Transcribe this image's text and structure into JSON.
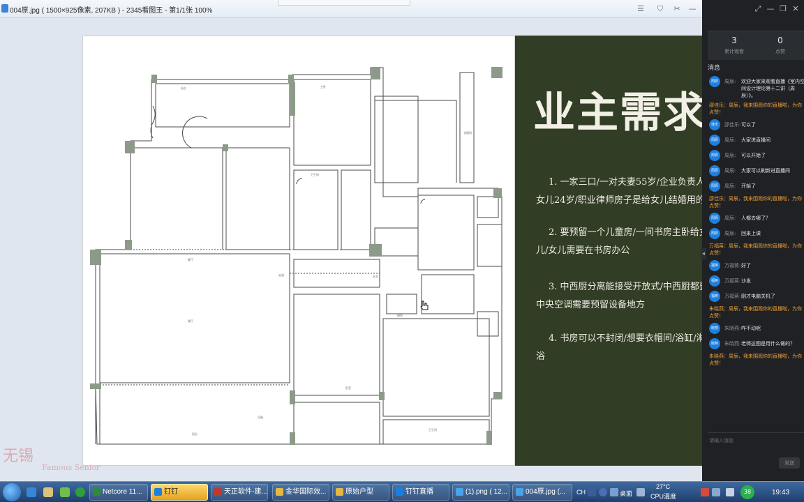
{
  "viewer": {
    "title": "004原.jpg ( 1500×925像素, 207KB ) - 2345看图王 - 第1/1张 100%",
    "controls": [
      "☰",
      "⛉",
      "✂",
      "—",
      "❐",
      "✕"
    ]
  },
  "slide": {
    "title": "业主需求",
    "requirements": [
      [
        "1. 一家三口/一对夫妻55岁/企业负责人",
        "女儿24岁/职业律师房子是给女儿结婚用的"
      ],
      [
        "2. 要预留一个儿童房/一间书房主卧给女",
        "儿/女儿需要在书房办公"
      ],
      [
        "3. 中西厨分离能接受开放式/中西厨都要",
        "中央空调需要预留设备地方"
      ],
      [
        "4. 书房可以不封闭/想要衣帽间/浴缸/淋",
        "浴"
      ]
    ]
  },
  "watermark": {
    "main": "无锡",
    "sub": "Famous Senior"
  },
  "live": {
    "controls": [
      "⤢",
      "—",
      "❐",
      "✕"
    ],
    "stats": [
      {
        "value": "3",
        "label": "累计观看"
      },
      {
        "value": "0",
        "label": "点赞"
      }
    ],
    "messages_header": "消息",
    "messages": [
      {
        "type": "user",
        "avatar": "周辰",
        "name": "周辰:",
        "text": "欢迎大家来观看直播《室内空间设计理论第十二讲（周辰）》。",
        "wrap": true
      },
      {
        "type": "system",
        "lines": [
          "邵佳乐：周辰，我来围观你的直播啦，为你",
          "点赞！"
        ]
      },
      {
        "type": "user",
        "avatar": "佳乐",
        "name": "邵佳乐:",
        "text": "可以了"
      },
      {
        "type": "user",
        "avatar": "周辰",
        "name": "周辰:",
        "text": "大家进直播间"
      },
      {
        "type": "user",
        "avatar": "周辰",
        "name": "周辰:",
        "text": "可以开始了"
      },
      {
        "type": "user",
        "avatar": "周辰",
        "name": "周辰:",
        "text": "大家可以刷新进直播间"
      },
      {
        "type": "user",
        "avatar": "周辰",
        "name": "周辰:",
        "text": "开始了"
      },
      {
        "type": "system",
        "lines": [
          "邵佳乐：周辰，我来围观你的直播啦，为你",
          "点赞！"
        ]
      },
      {
        "type": "user",
        "avatar": "周辰",
        "name": "周辰:",
        "text": "人都去哪了？"
      },
      {
        "type": "user",
        "avatar": "周辰",
        "name": "周辰:",
        "text": "回来上课"
      },
      {
        "type": "system",
        "lines": [
          "万福蒋：周辰，我来围观你的直播啦，为你",
          "点赞！"
        ]
      },
      {
        "type": "user",
        "avatar": "福蒋",
        "name": "万福蒋:",
        "text": "好了"
      },
      {
        "type": "user",
        "avatar": "福蒋",
        "name": "万福蒋:",
        "text": "沙发"
      },
      {
        "type": "user",
        "avatar": "福蒋",
        "name": "万福蒋:",
        "text": "刚才电脑关机了"
      },
      {
        "type": "system",
        "lines": [
          "朱晓燕：周辰，我来围观你的直播啦，为你",
          "点赞！"
        ]
      },
      {
        "type": "user",
        "avatar": "晓燕",
        "name": "朱晓燕:",
        "text": "咋不动呢"
      },
      {
        "type": "user",
        "avatar": "晓燕",
        "name": "朱晓燕:",
        "text": "老师这图是用什么做的？"
      },
      {
        "type": "system",
        "lines": [
          "朱晓燕：周辰，我来围观你的直播啦，为你",
          "点赞！"
        ]
      }
    ],
    "input_placeholder": "请输入消息",
    "send_label": "发送"
  },
  "taskbar": {
    "tasks": [
      {
        "label": "Netcore 11...",
        "icon_color": "#2f8a3a"
      },
      {
        "label": "钉钉",
        "icon_color": "#1b7fe0",
        "active": true
      },
      {
        "label": "天正软件-建...",
        "icon_color": "#c0392b"
      },
      {
        "label": "金华国际效...",
        "icon_color": "#e5b845"
      },
      {
        "label": "原始户型",
        "icon_color": "#e5b845"
      },
      {
        "label": "钉钉直播",
        "icon_color": "#1b7fe0"
      },
      {
        "label": "(1).png ( 12...",
        "icon_color": "#4aa3e8"
      },
      {
        "label": "004原.jpg (...",
        "icon_color": "#4aa3e8"
      }
    ],
    "lang": "CH",
    "desktop_label": "桌面",
    "temperature": "27°C",
    "cpu_label": "CPU温度",
    "badge": "38",
    "clock": "19:43"
  }
}
